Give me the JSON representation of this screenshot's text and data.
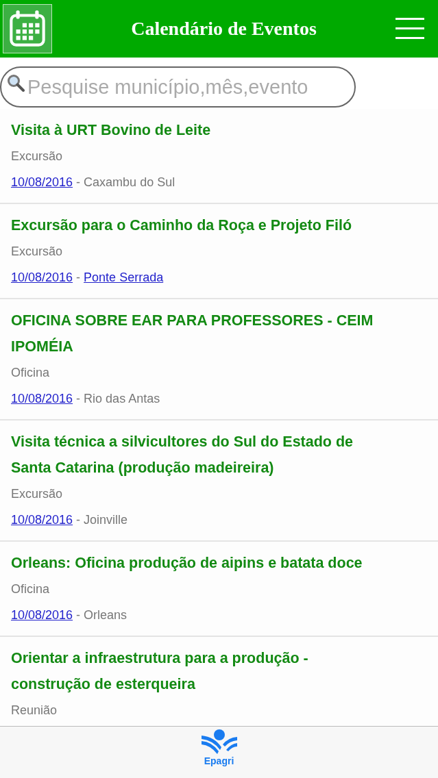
{
  "header": {
    "title": "Calendário de Eventos"
  },
  "search": {
    "placeholder": "Pesquise município,mês,evento"
  },
  "events": [
    {
      "title": "Visita à URT Bovino de Leite",
      "category": "Excursão",
      "date": "10/08/2016",
      "separator": "-",
      "place": "Caxambu do Sul",
      "place_link": false
    },
    {
      "title": "Excursão para o Caminho da Roça e Projeto Filó",
      "category": "Excursão",
      "date": "10/08/2016",
      "separator": "-",
      "place": "Ponte Serrada",
      "place_link": true
    },
    {
      "title": "OFICINA SOBRE EAR PARA PROFESSORES - CEIM IPOMÉIA",
      "category": "Oficina",
      "date": "10/08/2016",
      "separator": "-",
      "place": "Rio das Antas",
      "place_link": false
    },
    {
      "title": "Visita técnica a silvicultores do Sul do Estado de Santa Catarina (produção madeireira)",
      "category": "Excursão",
      "date": "10/08/2016",
      "separator": "-",
      "place": "Joinville",
      "place_link": false
    },
    {
      "title": "Orleans: Oficina produção de aipins e batata doce",
      "category": "Oficina",
      "date": "10/08/2016",
      "separator": "-",
      "place": "Orleans",
      "place_link": false
    },
    {
      "title": "Orientar a infraestrutura para a produção - construção de esterqueira",
      "category": "Reunião"
    }
  ],
  "footer": {
    "logo_text": "Epagri"
  }
}
